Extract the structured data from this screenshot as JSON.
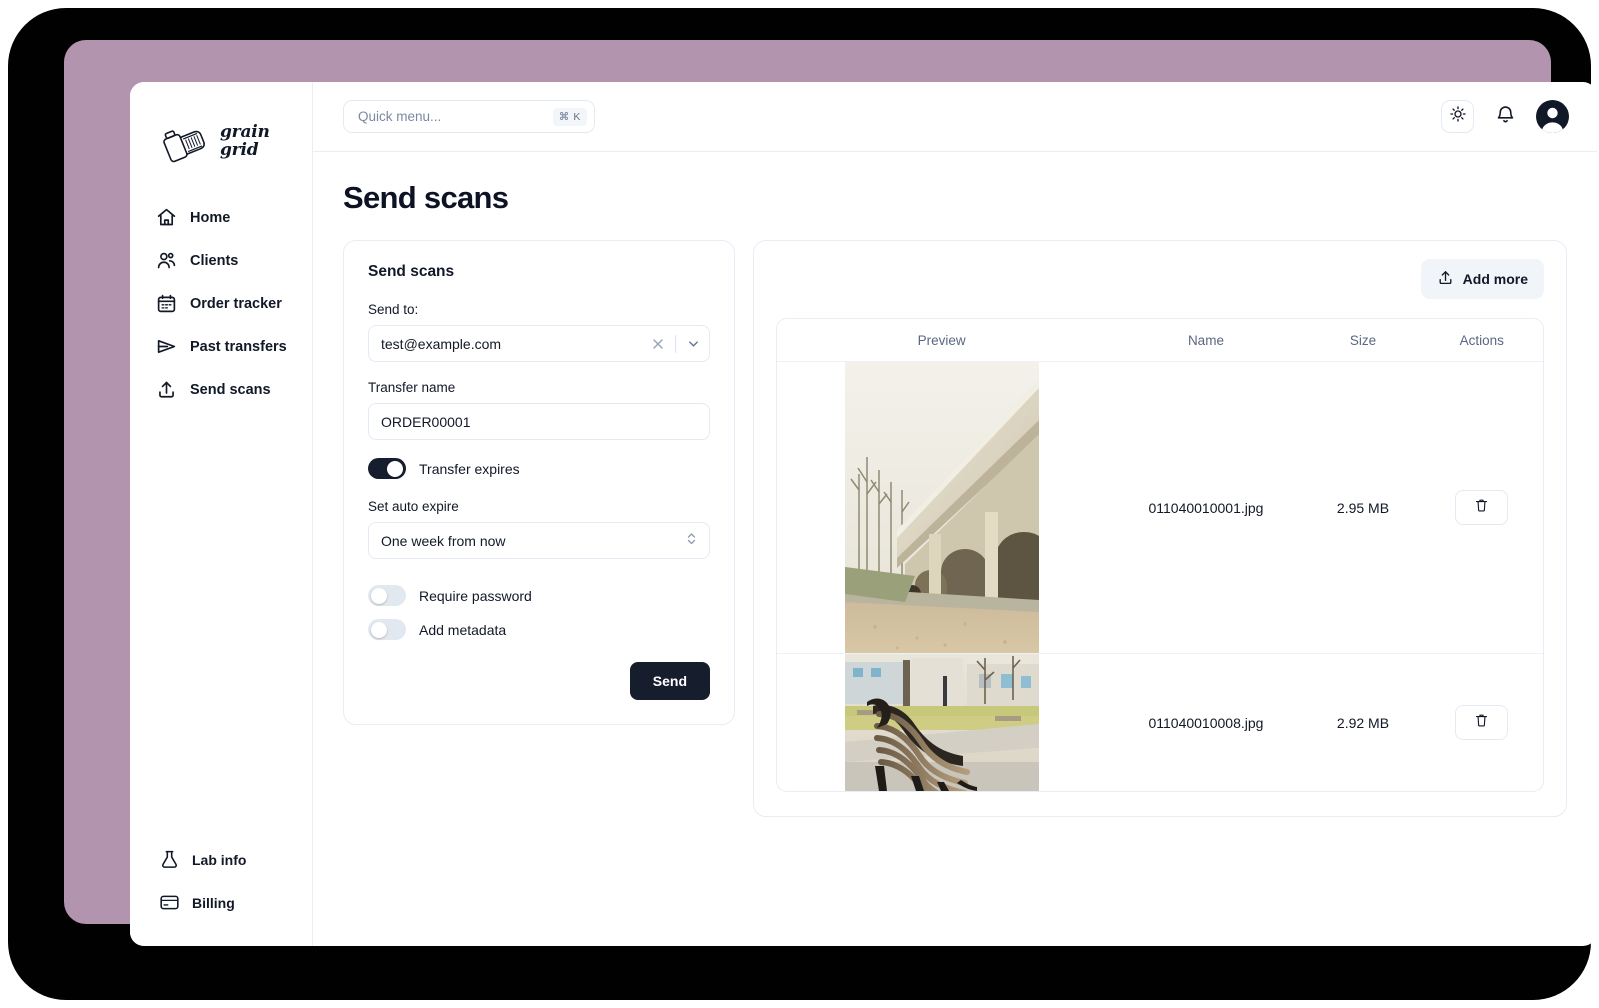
{
  "brand": {
    "logo_icon": "film-canister-icon",
    "name_line1": "grain",
    "name_line2": "grid"
  },
  "sidebar": {
    "items": [
      {
        "label": "Home",
        "icon": "home-icon"
      },
      {
        "label": "Clients",
        "icon": "users-icon"
      },
      {
        "label": "Order tracker",
        "icon": "calendar-icon"
      },
      {
        "label": "Past transfers",
        "icon": "send-plane-icon"
      },
      {
        "label": "Send scans",
        "icon": "upload-icon"
      }
    ],
    "bottom_items": [
      {
        "label": "Lab info",
        "icon": "flask-icon"
      },
      {
        "label": "Billing",
        "icon": "credit-card-icon"
      }
    ]
  },
  "topbar": {
    "search_placeholder": "Quick menu...",
    "search_value": "",
    "shortcut": "⌘ K",
    "theme_icon": "sun-icon",
    "notifications_icon": "bell-icon",
    "avatar_icon": "user-avatar"
  },
  "page": {
    "title": "Send scans"
  },
  "form": {
    "title": "Send scans",
    "send_to_label": "Send to:",
    "send_to_value": "test@example.com",
    "send_to_clear_icon": "close-icon",
    "send_to_chevron_icon": "chevron-down-icon",
    "transfer_name_label": "Transfer name",
    "transfer_name_value": "ORDER00001",
    "transfer_expires_label": "Transfer expires",
    "transfer_expires_on": true,
    "auto_expire_label": "Set auto expire",
    "auto_expire_value": "One week from now",
    "auto_expire_options": [
      "One week from now"
    ],
    "require_password_label": "Require password",
    "require_password_on": false,
    "add_metadata_label": "Add metadata",
    "add_metadata_on": false,
    "send_button": "Send"
  },
  "files_panel": {
    "add_more_label": "Add more",
    "add_more_icon": "upload-icon",
    "columns": [
      "Preview",
      "Name",
      "Size",
      "Actions"
    ],
    "rows": [
      {
        "name": "011040010001.jpg",
        "size": "2.95 MB",
        "preview_alt": "concrete viaduct arches photo",
        "delete_icon": "trash-icon"
      },
      {
        "name": "011040010008.jpg",
        "size": "2.92 MB",
        "preview_alt": "park bench photo",
        "delete_icon": "trash-icon"
      }
    ]
  },
  "colors": {
    "accent_dark": "#161e2e",
    "frame_band": "#b394ae",
    "bezel": "#010101",
    "border": "#e8edf5",
    "muted_text": "#5b6782"
  }
}
